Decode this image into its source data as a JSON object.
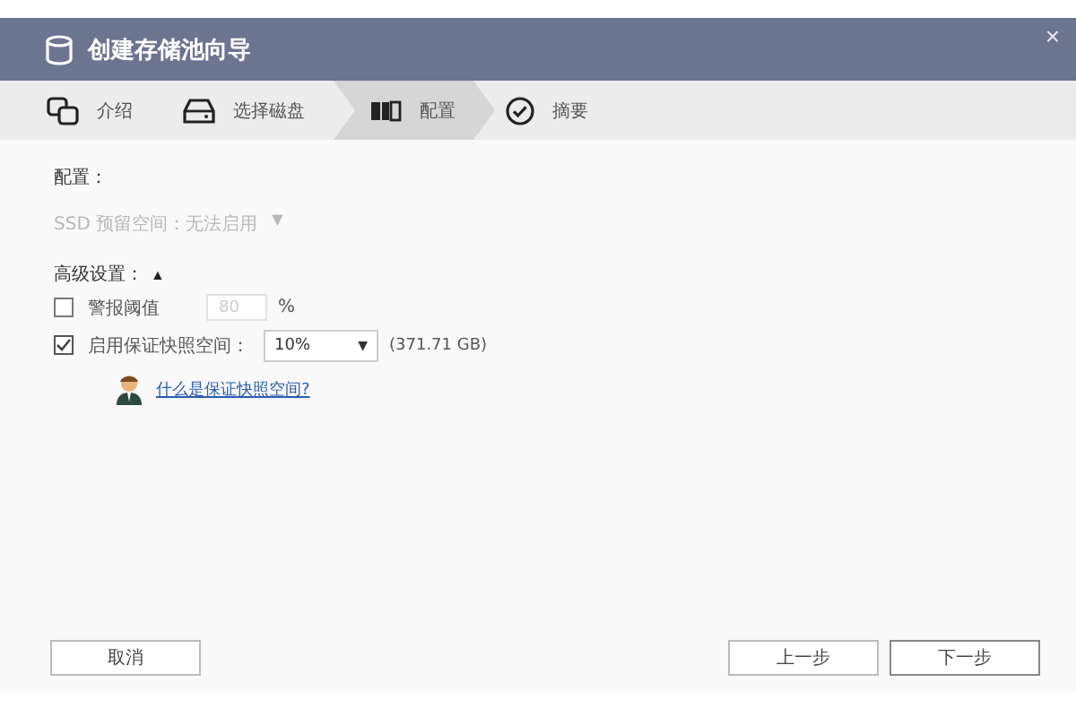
{
  "window": {
    "title": "创建存储池向导",
    "close": "×"
  },
  "steps": [
    {
      "label": "介绍",
      "kind": "intro",
      "selected": false
    },
    {
      "label": "选择磁盘",
      "kind": "disk",
      "selected": false
    },
    {
      "label": "配置",
      "kind": "config",
      "selected": true
    },
    {
      "label": "摘要",
      "kind": "summary",
      "selected": false
    }
  ],
  "config": {
    "label": "配置：",
    "ssd_option": {
      "text": "SSD 预留空间：无法启用",
      "arrow": "▼",
      "disabled": true
    }
  },
  "advanced": {
    "label": "高级设置：",
    "toggle": "▲",
    "options": [
      {
        "kind": "threshold",
        "label": "警报阈值",
        "checked": false,
        "value": "80",
        "unit": "%",
        "disabled": true
      },
      {
        "kind": "snapshot",
        "label": "启用保证快照空间：",
        "checked": true,
        "value": "10%",
        "detail": "(371.71 GB)"
      }
    ],
    "help_link": "什么是保证快照空间?"
  },
  "buttons": {
    "cancel": "取消",
    "back": "上一步",
    "next": "下一步"
  }
}
